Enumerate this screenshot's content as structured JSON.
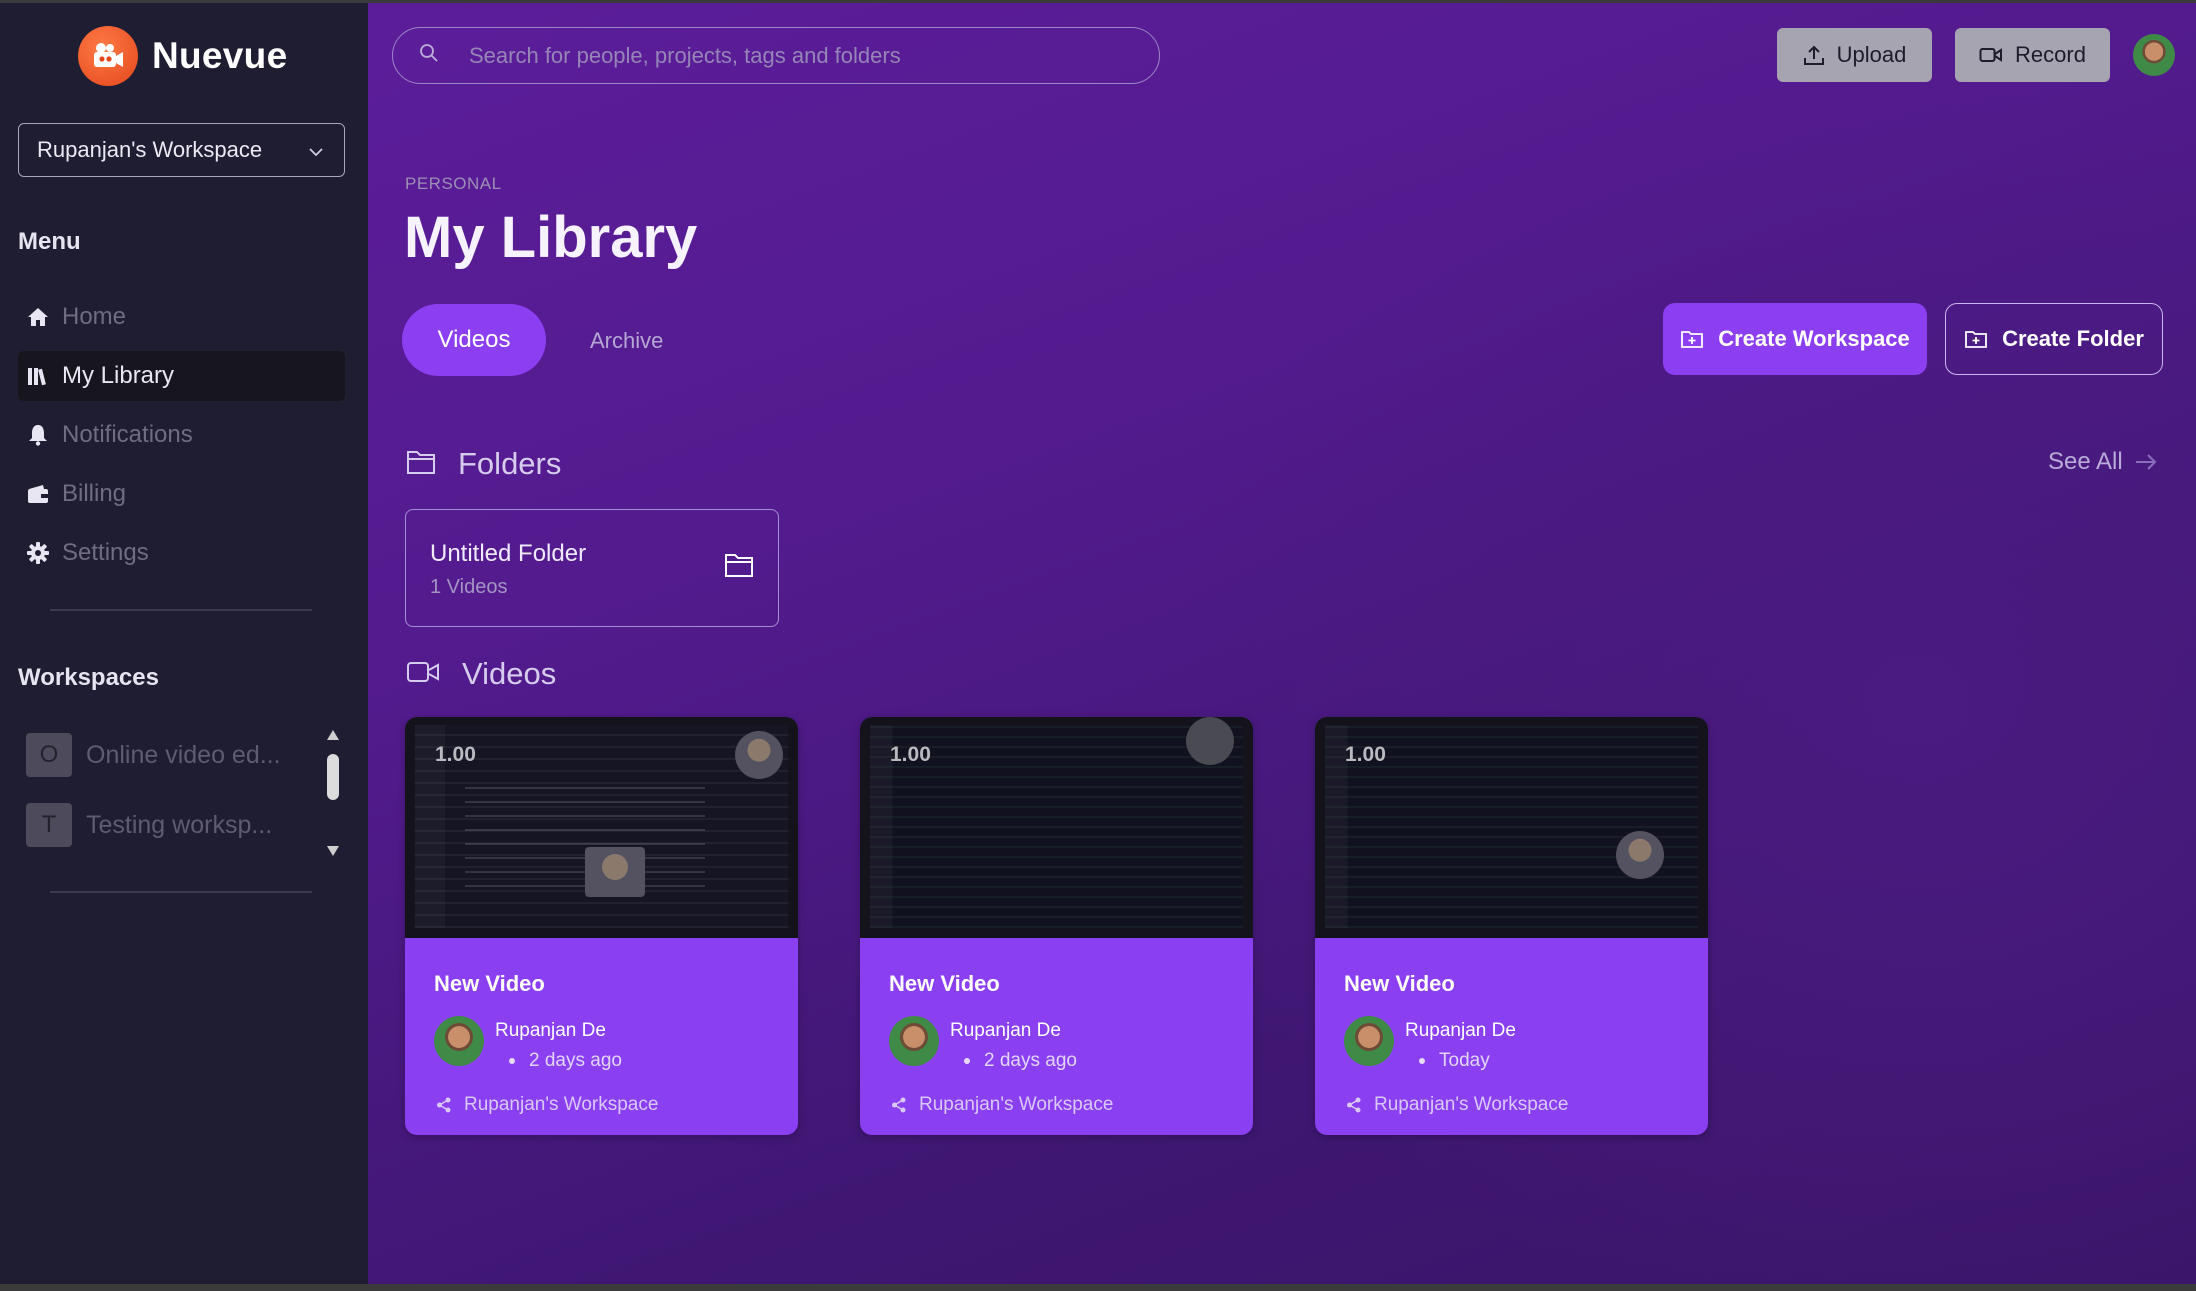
{
  "app": {
    "name": "Nuevue"
  },
  "sidebar": {
    "workspace_select": "Rupanjan's Workspace",
    "menu_title": "Menu",
    "items": [
      {
        "label": "Home",
        "icon": "home-icon",
        "active": false
      },
      {
        "label": "My Library",
        "icon": "library-icon",
        "active": true
      },
      {
        "label": "Notifications",
        "icon": "bell-icon",
        "active": false
      },
      {
        "label": "Billing",
        "icon": "wallet-icon",
        "active": false
      },
      {
        "label": "Settings",
        "icon": "gear-icon",
        "active": false
      }
    ],
    "workspaces_title": "Workspaces",
    "workspaces": [
      {
        "initial": "O",
        "name": "Online video ed..."
      },
      {
        "initial": "T",
        "name": "Testing worksp..."
      }
    ]
  },
  "header": {
    "search_placeholder": "Search for people, projects, tags and folders",
    "upload_label": "Upload",
    "record_label": "Record"
  },
  "page": {
    "eyebrow": "PERSONAL",
    "title": "My Library",
    "tabs": [
      {
        "label": "Videos",
        "active": true
      },
      {
        "label": "Archive",
        "active": false
      }
    ],
    "create_workspace_label": "Create Workspace",
    "create_folder_label": "Create Folder"
  },
  "folders": {
    "title": "Folders",
    "see_all": "See All",
    "items": [
      {
        "name": "Untitled Folder",
        "count": "1 Videos"
      }
    ]
  },
  "videos": {
    "title": "Videos",
    "items": [
      {
        "title": "New Video",
        "author": "Rupanjan De",
        "when": "2 days ago",
        "workspace": "Rupanjan's Workspace",
        "speed": "1.00"
      },
      {
        "title": "New Video",
        "author": "Rupanjan De",
        "when": "2 days ago",
        "workspace": "Rupanjan's Workspace",
        "speed": "1.00"
      },
      {
        "title": "New Video",
        "author": "Rupanjan De",
        "when": "Today",
        "workspace": "Rupanjan's Workspace",
        "speed": "1.00"
      }
    ]
  },
  "colors": {
    "accent": "#8b3ff0",
    "sidebar_bg": "#1f1d31",
    "main_bg": "#531b8e",
    "logo": "#e2461c"
  }
}
